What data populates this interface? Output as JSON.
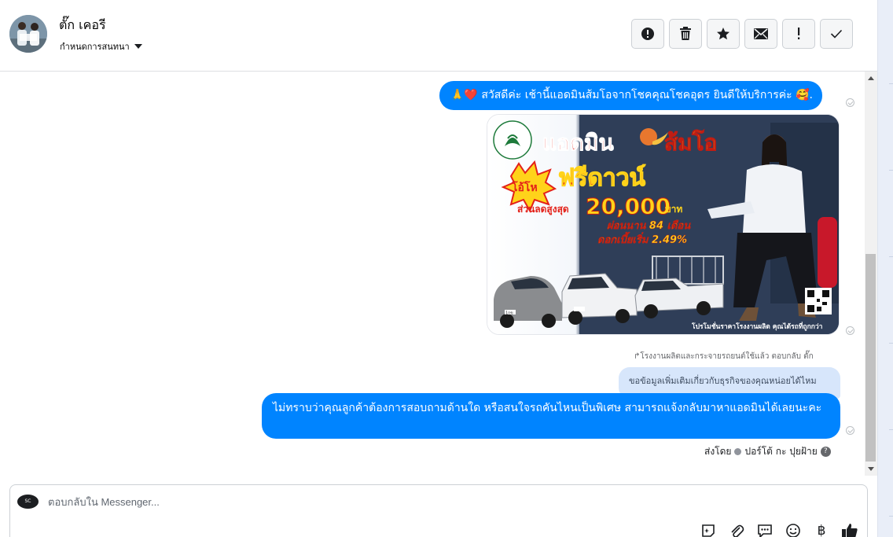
{
  "contact": {
    "name": "ตั๊ก เคอรี",
    "assign_label": "กำหนดการสนทนา"
  },
  "toolbar": {
    "icons": [
      "alert-circle-icon",
      "trash-icon",
      "star-icon",
      "envelope-icon",
      "exclamation-icon",
      "check-icon"
    ]
  },
  "messages": {
    "greeting": "🙏❤️ สวัสดีค่ะ เช้านี้แอดมินส้มโอจากโชคคุณโชคอุดร ยินดีให้บริการค่ะ 🥰.",
    "reply_meta": "↱โรงงานผลิตและกระจายรถยนต์ใช้แล้ว ตอบกลับ ตั๊ก",
    "quoted_text": "ขอข้อมูลเพิ่มเติมเกี่ยวกับธุรกิจของคุณหน่อยได้ไหม",
    "followup": "ไม่ทราบว่าคุณลูกค้าต้องการสอบถามด้านใด หรือสนใจรถคันไหนเป็นพิเศษ สามารถแจ้งกลับมาหาแอดมินได้เลยนะคะ",
    "sent_by_prefix": "ส่งโดย",
    "sent_by_name": "ปอร์โต้ กะ ปุยฝ้าย",
    "help_glyph": "?"
  },
  "promo": {
    "headline": "แอดมิน",
    "headline_name": "ส้มโอ",
    "badge": "โอ้โห",
    "offer": "ฟรีดาวน์",
    "discount_label": "ส่วนลดสูงสุด",
    "discount_amount": "20,000",
    "currency": "บาท",
    "installment": "ผ่อนนาน 84 เดือน",
    "interest": "ดอกเบี้ยเริ่ม 2.49%",
    "footer": "โปรโมชั่นราคาโรงงานผลิต คุณได้รถที่ถูกกว่า",
    "plate": "1กข"
  },
  "composer": {
    "placeholder": "ตอบกลับใน Messenger...",
    "avatar_text": "SC",
    "icons": [
      "sticker-icon",
      "paperclip-icon",
      "chat-bubble-icon",
      "emoji-icon",
      "baht-icon",
      "thumbs-up-icon"
    ],
    "baht_glyph": "฿"
  }
}
